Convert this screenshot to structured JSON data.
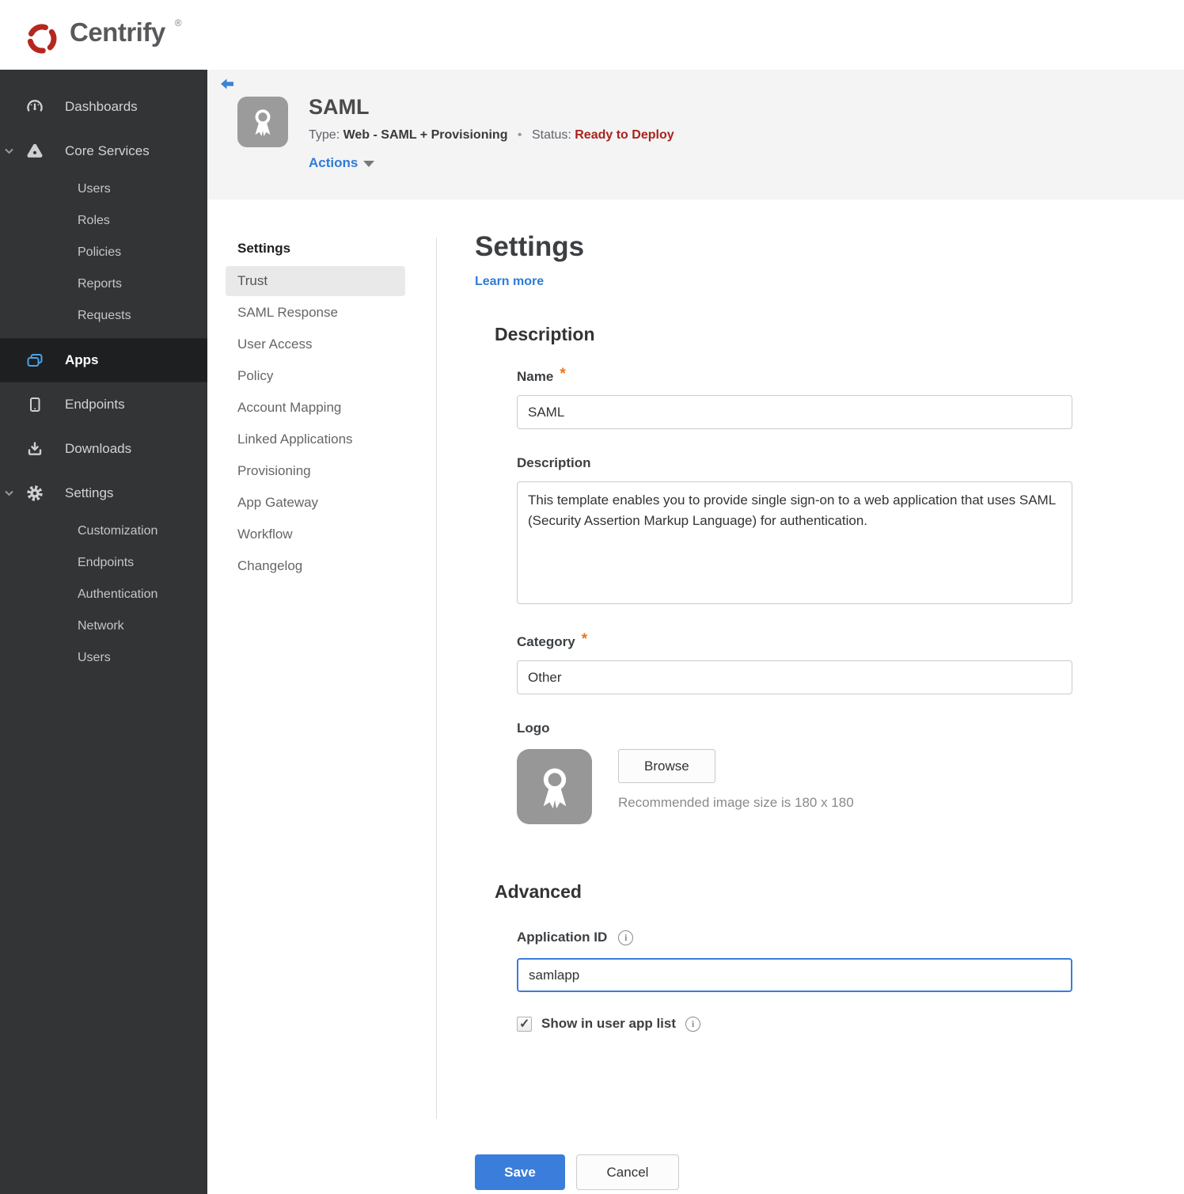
{
  "brand": {
    "name": "Centrify",
    "registered": "®"
  },
  "sidebar": {
    "dashboards": "Dashboards",
    "core_services": {
      "label": "Core Services",
      "children": [
        "Users",
        "Roles",
        "Policies",
        "Reports",
        "Requests"
      ]
    },
    "apps": "Apps",
    "endpoints": "Endpoints",
    "downloads": "Downloads",
    "settings": {
      "label": "Settings",
      "children": [
        "Customization",
        "Endpoints",
        "Authentication",
        "Network",
        "Users"
      ]
    }
  },
  "app_header": {
    "title": "SAML",
    "type_label": "Type:",
    "type_value": "Web - SAML + Provisioning",
    "separator": "•",
    "status_label": "Status:",
    "status_value": "Ready to Deploy",
    "actions_label": "Actions"
  },
  "subnav": {
    "header": "Settings",
    "active_item": "Trust",
    "items": [
      "Trust",
      "SAML Response",
      "User Access",
      "Policy",
      "Account Mapping",
      "Linked Applications",
      "Provisioning",
      "App Gateway",
      "Workflow",
      "Changelog"
    ]
  },
  "main": {
    "title": "Settings",
    "learn_more": "Learn more",
    "required_marker": "*",
    "description_section": {
      "heading": "Description",
      "name_label": "Name",
      "name_value": "SAML",
      "description_label": "Description",
      "description_value": "This template enables you to provide single sign-on to a web application that uses SAML (Security Assertion Markup Language) for authentication.",
      "category_label": "Category",
      "category_value": "Other",
      "logo_label": "Logo",
      "browse_button": "Browse",
      "logo_hint": "Recommended image size is 180 x 180"
    },
    "advanced_section": {
      "heading": "Advanced",
      "app_id_label": "Application ID",
      "app_id_value": "samlapp",
      "info_glyph": "i",
      "show_in_app_list_label": "Show in user app list",
      "checkbox_checked": true
    },
    "save_button": "Save",
    "cancel_button": "Cancel"
  },
  "colors": {
    "accent_blue": "#3b7dda",
    "link_blue": "#2e7cd6",
    "status_red": "#a8231c",
    "sidebar_bg": "#333436",
    "apps_icon_blue": "#4ba3e8",
    "required_orange": "#e87722",
    "brand_red": "#b5281f"
  }
}
